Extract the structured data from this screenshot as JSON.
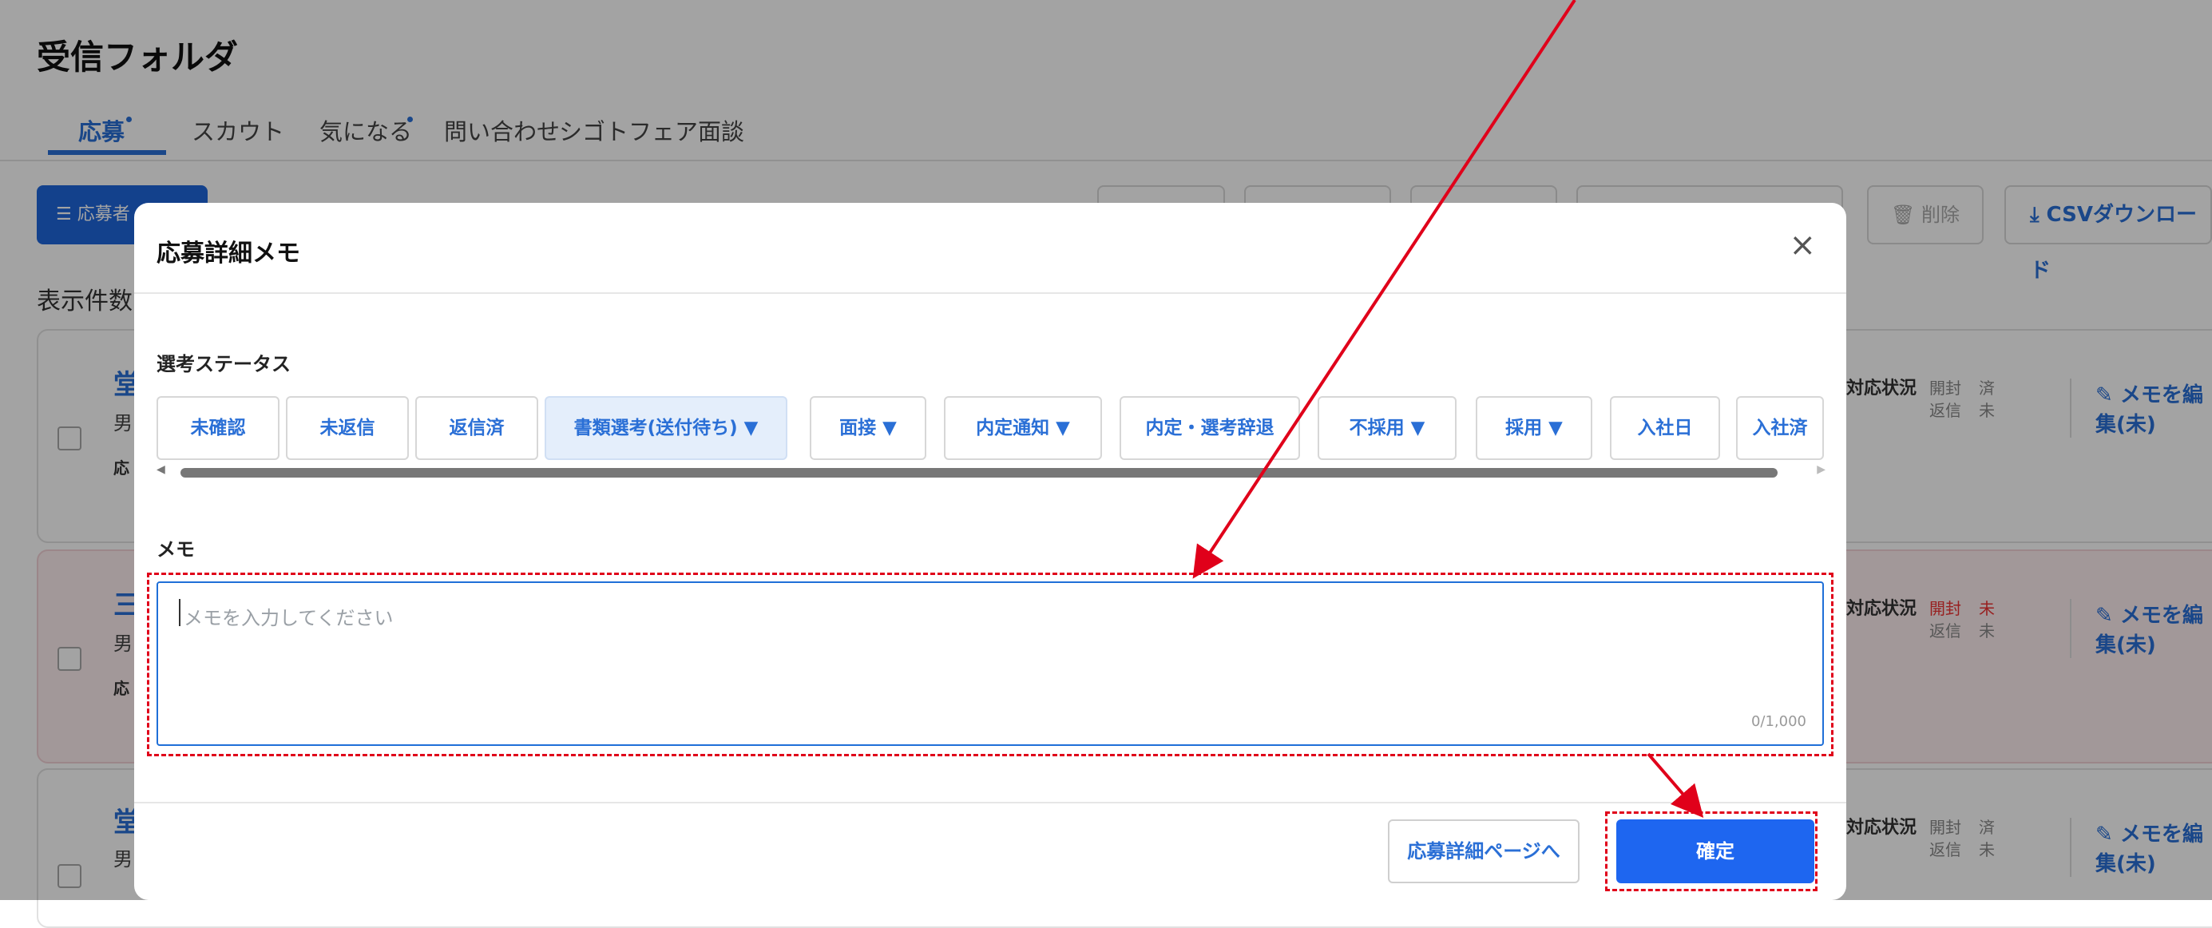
{
  "page": {
    "title": "受信フォルダ",
    "tabs": [
      {
        "label": "応募",
        "active": true,
        "dot": true
      },
      {
        "label": "スカウト",
        "active": false,
        "dot": false
      },
      {
        "label": "気になる",
        "active": false,
        "dot": true
      },
      {
        "label": "問い合わせ",
        "active": false,
        "dot": false
      },
      {
        "label": "シゴトフェア面談",
        "active": false,
        "dot": false
      }
    ],
    "filter_button": "応募者",
    "delete_button": "削除",
    "csv_button": "CSVダウンロード",
    "count_label": "表示件数：",
    "cards": [
      {
        "name": "堂",
        "sex": "男",
        "applied": "応",
        "highlight": false,
        "status_label": "対応状況",
        "open_label": "開封",
        "open_value": "済",
        "reply_label": "返信",
        "reply_value": "未",
        "memo_button": "メモを編集(未)"
      },
      {
        "name": "三",
        "sex": "男",
        "applied": "応",
        "highlight": true,
        "status_label": "対応状況",
        "open_label": "開封",
        "open_value": "未",
        "reply_label": "返信",
        "reply_value": "未",
        "memo_button": "メモを編集(未)"
      },
      {
        "name": "堂",
        "sex": "男",
        "applied": "",
        "highlight": false,
        "status_label": "対応状況",
        "open_label": "開封",
        "open_value": "済",
        "reply_label": "返信",
        "reply_value": "未",
        "memo_button": "メモを編集(未)"
      }
    ]
  },
  "modal": {
    "title": "応募詳細メモ",
    "close_icon": "×",
    "status_section_label": "選考ステータス",
    "status_chips": [
      {
        "label": "未確認",
        "selected": false
      },
      {
        "label": "未返信",
        "selected": false
      },
      {
        "label": "返信済",
        "selected": false
      },
      {
        "label": "書類選考(送付待ち) ▼",
        "selected": true
      },
      {
        "label": "面接 ▼",
        "selected": false
      },
      {
        "label": "内定通知 ▼",
        "selected": false
      },
      {
        "label": "内定・選考辞退",
        "selected": false
      },
      {
        "label": "不採用 ▼",
        "selected": false
      },
      {
        "label": "採用 ▼",
        "selected": false
      },
      {
        "label": "入社日",
        "selected": false
      },
      {
        "label": "入社済",
        "selected": false
      }
    ],
    "memo_section_label": "メモ",
    "memo_placeholder": "メモを入力してください",
    "memo_value": "",
    "char_count": "0/1,000",
    "detail_button": "応募詳細ページへ",
    "confirm_button": "確定"
  },
  "colors": {
    "accent": "#1e66f0",
    "annotation": "#e0001a",
    "overlay": "rgba(0,0,0,0.36)"
  }
}
